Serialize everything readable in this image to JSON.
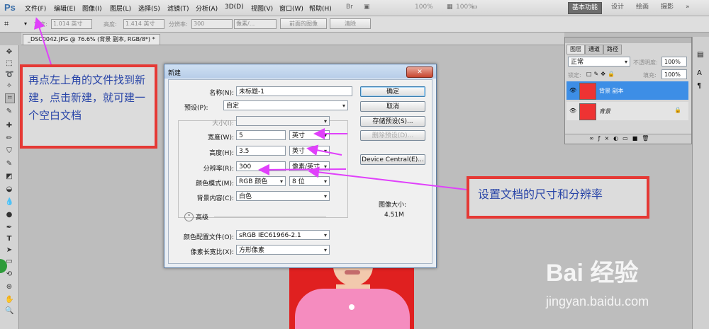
{
  "app": {
    "logo": "Ps"
  },
  "menu": [
    "文件(F)",
    "编辑(E)",
    "图像(I)",
    "图层(L)",
    "选择(S)",
    "滤镜(T)",
    "分析(A)",
    "3D(D)",
    "视图(V)",
    "窗口(W)",
    "帮助(H)"
  ],
  "menu_zoom_a": "100%",
  "menu_zoom_b": "100%",
  "workspaces": [
    "基本功能",
    "设计",
    "绘画",
    "摄影"
  ],
  "options_bar": {
    "width_label": "宽度:",
    "width_value": "1.014 英寸",
    "height_label": "高度:",
    "height_value": "1.414 英寸",
    "resolution_label": "分辨率:",
    "resolution_value": "300",
    "unit_value": "像素/...",
    "front_image_btn": "前面的图像",
    "clear_btn": "清除"
  },
  "doc_tab": "_DSC0042.JPG @ 76.6% (背景 副本, RGB/8*) *",
  "layers_panel": {
    "tabs": [
      "图层",
      "通道",
      "路径"
    ],
    "blend_mode": "正常",
    "opacity_label": "不透明度:",
    "opacity_value": "100%",
    "lock_label": "锁定:",
    "fill_label": "填充:",
    "fill_value": "100%",
    "layers": [
      {
        "name": "背景 副本",
        "selected": true
      },
      {
        "name": "背景",
        "selected": false
      }
    ]
  },
  "dialog": {
    "title": "新建",
    "name_label": "名称(N):",
    "name_value": "未标题-1",
    "preset_label": "预设(P):",
    "preset_value": "自定",
    "size_label": "大小(I):",
    "width_label": "宽度(W):",
    "width_value": "5",
    "width_unit": "英寸",
    "height_label": "高度(H):",
    "height_value": "3.5",
    "height_unit": "英寸",
    "resolution_label": "分辨率(R):",
    "resolution_value": "300",
    "resolution_unit": "像素/英寸",
    "color_mode_label": "颜色模式(M):",
    "color_mode_value": "RGB 颜色",
    "bit_depth_value": "8 位",
    "bg_label": "背景内容(C):",
    "bg_value": "白色",
    "advanced_label": "高级",
    "profile_label": "颜色配置文件(O):",
    "profile_value": "sRGB IEC61966-2.1",
    "pixel_aspect_label": "像素长宽比(X):",
    "pixel_aspect_value": "方形像素",
    "ok_btn": "确定",
    "cancel_btn": "取消",
    "save_preset_btn": "存储预设(S)...",
    "delete_preset_btn": "删除预设(D)...",
    "device_central_btn": "Device Central(E)...",
    "image_size_label": "图像大小:",
    "image_size_value": "4.51M"
  },
  "annotations": {
    "top_left": "再点左上角的文件找到新建，点击新建，就可建一个空白文档",
    "right": "设置文档的尺寸和分辨率"
  },
  "watermark": {
    "brand": "Bai 经验",
    "url": "jingyan.baidu.com"
  },
  "colors": {
    "annotation_border": "#e53935",
    "annotation_text": "#2a46a8",
    "arrow": "#e040fb",
    "layer_selected": "#3d8ee6"
  }
}
